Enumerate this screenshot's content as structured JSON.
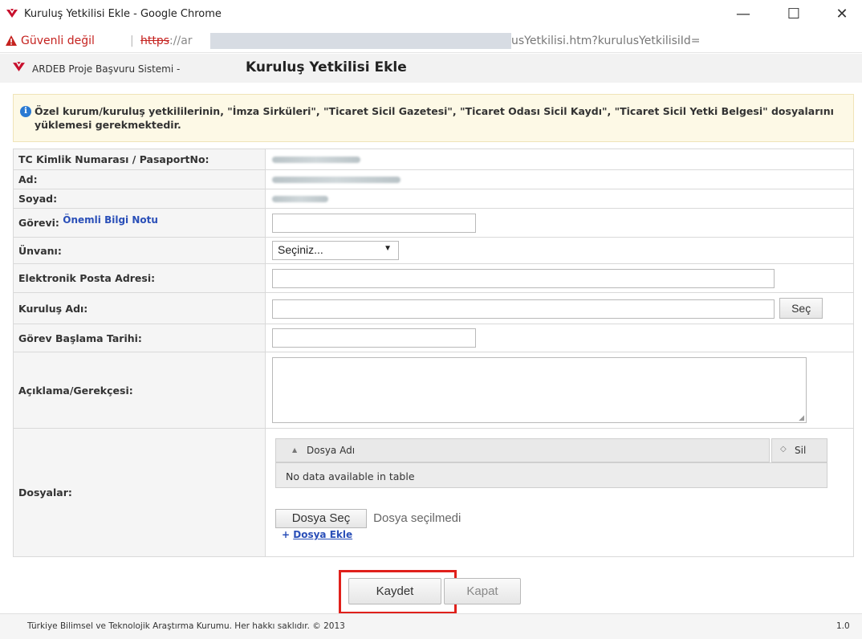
{
  "window": {
    "title": "Kuruluş Yetkilisi Ekle - Google Chrome",
    "min_glyph": "—",
    "max_glyph": "☐",
    "close_glyph": "✕"
  },
  "address": {
    "insecure_label": "Güvenli değil",
    "separator": "|",
    "scheme": "https",
    "scheme_sep": "://ar",
    "url_end": "usYetkilisi.htm?kurulusYetkilisiId="
  },
  "header": {
    "system_name": "ARDEB Proje Başvuru Sistemi -",
    "page_title": "Kuruluş Yetkilisi Ekle"
  },
  "info": {
    "icon": "i",
    "text": "Özel kurum/kuruluş yetkililerinin, \"İmza Sirküleri\", \"Ticaret Sicil Gazetesi\", \"Ticaret Odası Sicil Kaydı\", \"Ticaret Sicil Yetki Belgesi\" dosyalarını yüklemesi gerekmektedir."
  },
  "form": {
    "tc_label": "TC Kimlik Numarası / PasaportNo:",
    "ad_label": "Ad:",
    "soyad_label": "Soyad:",
    "gorevi_label": "Görevi:",
    "gorevi_note_link": "Önemli Bilgi Notu",
    "gorevi_value": "",
    "unvani_label": "Ünvanı:",
    "unvani_selected": "Seçiniz...",
    "email_label": "Elektronik Posta Adresi:",
    "email_value": "",
    "kurulus_label": "Kuruluş Adı:",
    "kurulus_value": "",
    "sec_button": "Seç",
    "baslama_label": "Görev Başlama Tarihi:",
    "baslama_value": "",
    "aciklama_label": "Açıklama/Gerekçesi:",
    "aciklama_value": "",
    "dosyalar_label": "Dosyalar:"
  },
  "files": {
    "col_name": "Dosya Adı",
    "col_delete": "Sil",
    "sort_glyph_name": "▲",
    "sort_glyph_delete": "◇",
    "empty_text": "No data available in table",
    "choose_button": "Dosya Seç",
    "no_file_text": "Dosya seçilmedi",
    "add_link": "Dosya Ekle",
    "add_bullet": "+"
  },
  "actions": {
    "save": "Kaydet",
    "close": "Kapat"
  },
  "footer": {
    "copyright": "Türkiye Bilimsel ve Teknolojik Araştırma Kurumu. Her hakkı saklıdır. © 2013",
    "version": "1.0"
  },
  "colors": {
    "accent_red": "#e0201b",
    "link_blue": "#2a4fb8",
    "info_bg": "#fdf9e6"
  }
}
